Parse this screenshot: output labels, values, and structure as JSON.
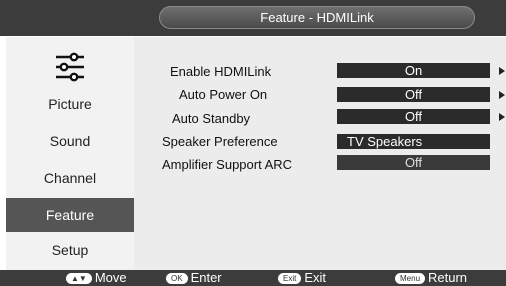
{
  "header": {
    "title": "Feature - HDMILink"
  },
  "sidebar": {
    "logo_icon": "sliders-icon",
    "items": [
      {
        "label": "Picture"
      },
      {
        "label": "Sound"
      },
      {
        "label": "Channel"
      },
      {
        "label": "Feature",
        "active": true
      },
      {
        "label": "Setup"
      }
    ]
  },
  "settings": [
    {
      "label": "Enable HDMILink",
      "value": "On",
      "has_submenu": true
    },
    {
      "label": "Auto Power On",
      "value": "Off",
      "has_submenu": true
    },
    {
      "label": "Auto Standby",
      "value": "Off",
      "has_submenu": true
    },
    {
      "label": "Speaker Preference",
      "value": "TV Speakers",
      "has_submenu": false
    },
    {
      "label": "Amplifier Support ARC",
      "value": "Off",
      "has_submenu": false,
      "disabled": true
    }
  ],
  "footer": {
    "move_key": "▲▼",
    "move_label": "Move",
    "enter_key": "OK",
    "enter_label": "Enter",
    "exit_key": "Exit",
    "exit_label": "Exit",
    "return_key": "Menu",
    "return_label": "Return"
  },
  "colors": {
    "bar": "#3c3c3c",
    "selected_item": "#555555",
    "value_box": "#2b2b2b"
  }
}
